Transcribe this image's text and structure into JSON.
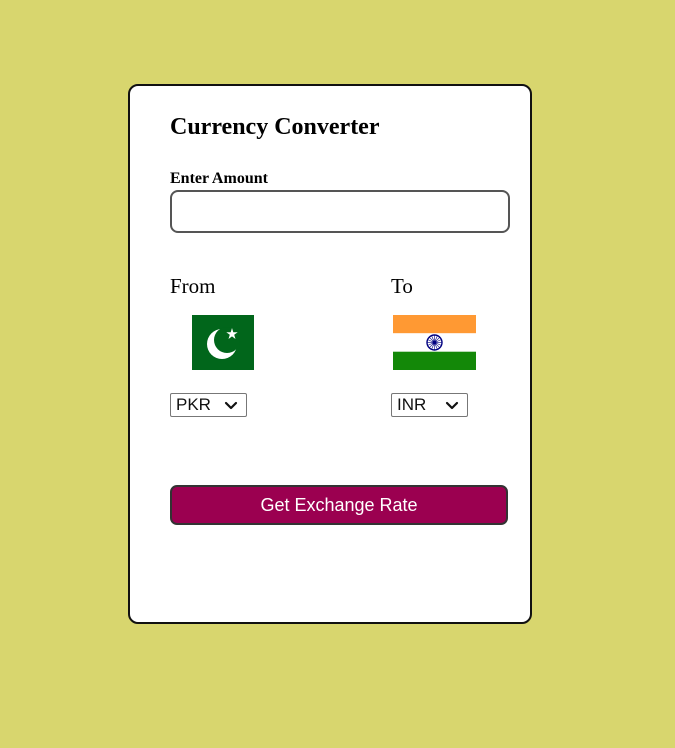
{
  "card": {
    "title": "Currency Converter",
    "amount_label": "Enter Amount",
    "amount_value": "",
    "from": {
      "label": "From",
      "flag_icon": "pakistan-flag-icon",
      "selected_currency": "PKR"
    },
    "to": {
      "label": "To",
      "flag_icon": "india-flag-icon",
      "selected_currency": "INR"
    },
    "button_label": "Get Exchange Rate"
  },
  "colors": {
    "page_background": "#d8d66e",
    "card_background": "#ffffff",
    "button_background": "#9b0050",
    "button_text": "#ffffff"
  }
}
